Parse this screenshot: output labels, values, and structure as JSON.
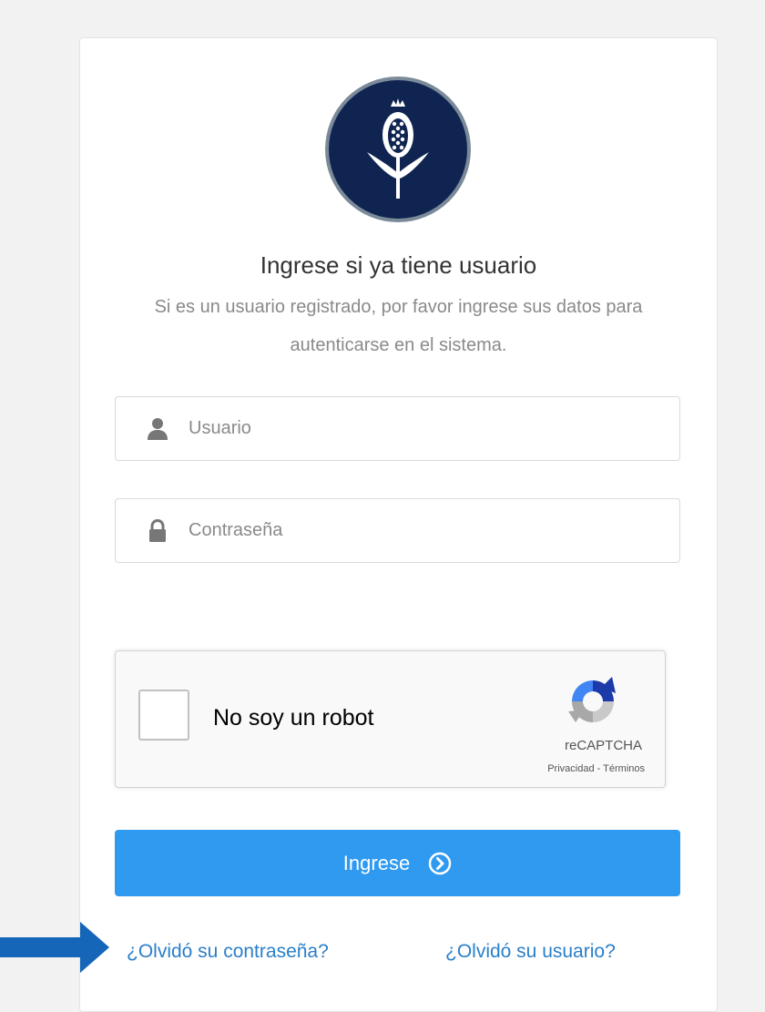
{
  "login": {
    "title": "Ingrese si ya tiene usuario",
    "subtitle": "Si es un usuario registrado, por favor ingrese sus datos para autenticarse en el sistema.",
    "username_placeholder": "Usuario",
    "password_placeholder": "Contraseña",
    "submit_label": "Ingrese",
    "forgot_password": "¿Olvidó su contraseña?",
    "forgot_username": "¿Olvidó su usuario?"
  },
  "captcha": {
    "label": "No soy un robot",
    "brand": "reCAPTCHA",
    "privacy": "Privacidad",
    "separator": " - ",
    "terms": "Términos"
  },
  "icons": {
    "logo": "pomegranate-flower-logo",
    "username": "user-icon",
    "password": "lock-icon",
    "submit": "chevron-circle-right-icon",
    "recaptcha": "recaptcha-icon",
    "annotation": "arrow-right-icon"
  },
  "colors": {
    "primary_button": "#2f9af0",
    "link": "#2a7fc9",
    "logo_background": "#0f2451",
    "annotation_arrow": "#1565b8",
    "page_background": "#f2f2f2"
  }
}
